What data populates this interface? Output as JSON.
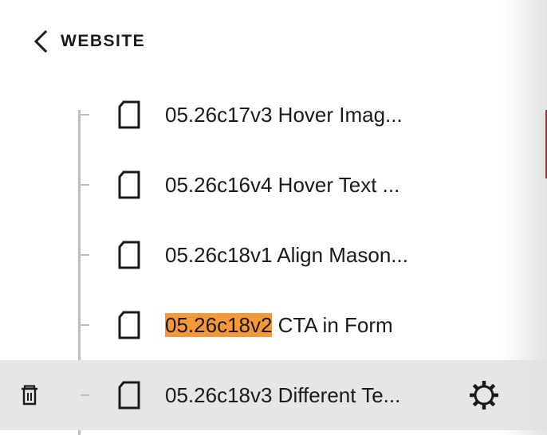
{
  "header": {
    "title": "WEBSITE"
  },
  "pages": [
    {
      "label": "05.26c17v3 Hover Imag..."
    },
    {
      "label": "05.26c16v4 Hover Text ..."
    },
    {
      "label": "05.26c18v1 Align Mason..."
    },
    {
      "label_match": "05.26c18v2",
      "label_rest": " CTA in Form"
    },
    {
      "label": "05.26c18v3 Different Te...",
      "selected": true
    }
  ],
  "colors": {
    "highlight": "#f7983a",
    "selected_row": "#e6e6e6",
    "tree_line": "#bdbdbd",
    "accent": "#a0344a"
  }
}
